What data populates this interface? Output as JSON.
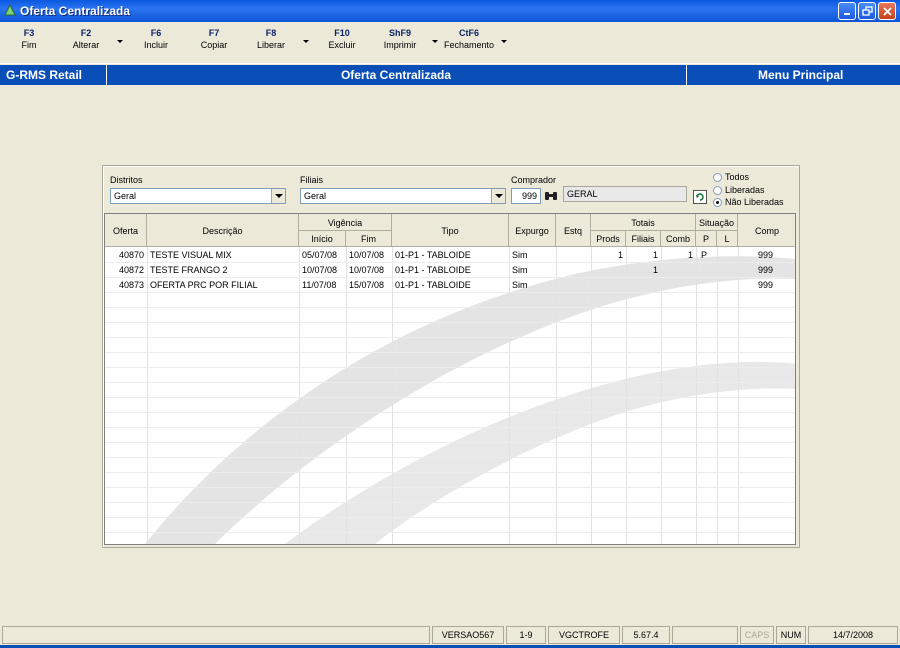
{
  "window": {
    "title": "Oferta Centralizada"
  },
  "toolbar": {
    "buttons": [
      {
        "key": "F3",
        "label": "Fim"
      },
      {
        "key": "F2",
        "label": "Alterar"
      },
      {
        "key": "F6",
        "label": "Incluir"
      },
      {
        "key": "F7",
        "label": "Copiar"
      },
      {
        "key": "F8",
        "label": "Liberar"
      },
      {
        "key": "F10",
        "label": "Excluir"
      },
      {
        "key": "ShF9",
        "label": "Imprimir"
      },
      {
        "key": "CtF6",
        "label": "Fechamento"
      }
    ]
  },
  "navbar": {
    "left": "G-RMS Retail",
    "center": "Oferta Centralizada",
    "right": "Menu Principal"
  },
  "filters": {
    "distritos_label": "Distritos",
    "distritos_value": "Geral",
    "filiais_label": "Filiais",
    "filiais_value": "Geral",
    "comprador_label": "Comprador",
    "comprador_code": "999",
    "comprador_name": "GERAL",
    "radios": [
      {
        "label": "Todos",
        "selected": false
      },
      {
        "label": "Liberadas",
        "selected": false
      },
      {
        "label": "Não Liberadas",
        "selected": true
      }
    ]
  },
  "grid": {
    "headers": {
      "oferta": "Oferta",
      "descricao": "Descrição",
      "vigencia": "Vigência",
      "inicio": "Início",
      "fim": "Fim",
      "tipo": "Tipo",
      "expurgo": "Expurgo",
      "estq": "Estq",
      "totais": "Totais",
      "prods": "Prods",
      "filiais": "Filiais",
      "comb": "Comb",
      "situacao": "Situação",
      "p": "P",
      "l": "L",
      "comp": "Comp"
    },
    "rows": [
      {
        "oferta": "40870",
        "descricao": "TESTE VISUAL MIX",
        "inicio": "05/07/08",
        "fim": "10/07/08",
        "tipo": "01-P1 - TABLOIDE",
        "expurgo": "Sim",
        "estq": "",
        "prods": "1",
        "filiais": "1",
        "comb": "1",
        "p": "P",
        "l": "",
        "comp": "999"
      },
      {
        "oferta": "40872",
        "descricao": "TESTE FRANGO 2",
        "inicio": "10/07/08",
        "fim": "10/07/08",
        "tipo": "01-P1 - TABLOIDE",
        "expurgo": "Sim",
        "estq": "",
        "prods": "",
        "filiais": "1",
        "comb": "",
        "p": "",
        "l": "",
        "comp": "999"
      },
      {
        "oferta": "40873",
        "descricao": "OFERTA PRC POR FILIAL",
        "inicio": "11/07/08",
        "fim": "15/07/08",
        "tipo": "01-P1 - TABLOIDE",
        "expurgo": "Sim",
        "estq": "",
        "prods": "",
        "filiais": "",
        "comb": "",
        "p": "",
        "l": "",
        "comp": "999"
      }
    ]
  },
  "statusbar": {
    "version": "VERSAO567",
    "page": "1-9",
    "program": "VGCTROFE",
    "release": "5.67.4",
    "caps": "CAPS",
    "num": "NUM",
    "date": "14/7/2008"
  },
  "colors": {
    "titlebar": "#0a58e0",
    "navbar": "#0a4fb8",
    "background": "#ece9d8"
  }
}
